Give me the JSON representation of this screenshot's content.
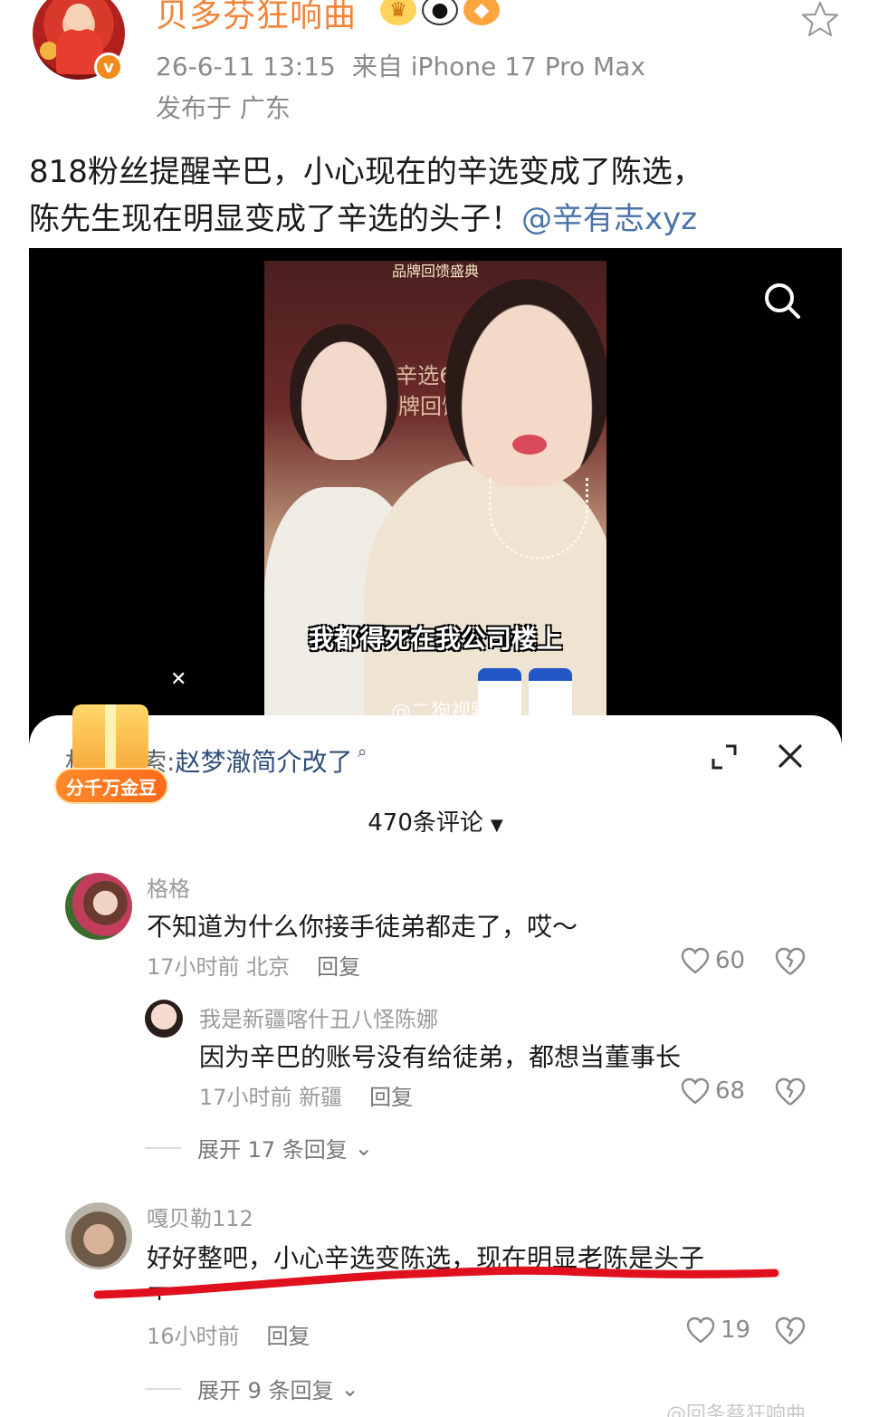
{
  "post": {
    "username": "贝多芬狂响曲",
    "timestamp": "26-6-11 13:15",
    "source": "来自 iPhone 17 Pro Max",
    "location": "发布于 广东",
    "text_line1": "818粉丝提醒辛巴，小心现在的辛选变成了陈选，",
    "text_line2_plain": "陈先生现在明显变成了辛选的头子！",
    "text_line2_mention": "@辛有志xyz"
  },
  "video": {
    "frame_banner": "品牌回馈盛典",
    "frame_watermark": "辛选618 品牌回馈盛典",
    "caption": "我都得死在我公司楼上",
    "watermark": "@二狗视野"
  },
  "sheet": {
    "search_prefix": "相关搜索:",
    "search_term": "赵梦澈简介改了",
    "comment_count": "470条评论",
    "gift_label": "分千万金豆"
  },
  "comments": [
    {
      "name": "格格",
      "text": "不知道为什么你接手徒弟都走了，哎～",
      "time": "17小时前 北京",
      "reply": "回复",
      "likes": "60"
    },
    {
      "name": "我是新疆喀什丑八怪陈娜",
      "text": "因为辛巴的账号没有给徒弟，都想当董事长",
      "time": "17小时前 新疆",
      "reply": "回复",
      "likes": "68"
    },
    {
      "expand": "展开 17 条回复"
    },
    {
      "name": "嘎贝勒112",
      "text": "好好整吧，小心辛选变陈选，现在明显老陈是头子",
      "text_overflow": "了......",
      "time": "16小时前",
      "reply": "回复",
      "likes": "19"
    },
    {
      "expand": "展开 9 条回复"
    }
  ],
  "footer_watermark": "@回条蔡狂响曲",
  "colors": {
    "username": "#f0843a",
    "mention": "#4a73a8",
    "annotation": "#e0101e",
    "verified": "#f28b1c"
  }
}
